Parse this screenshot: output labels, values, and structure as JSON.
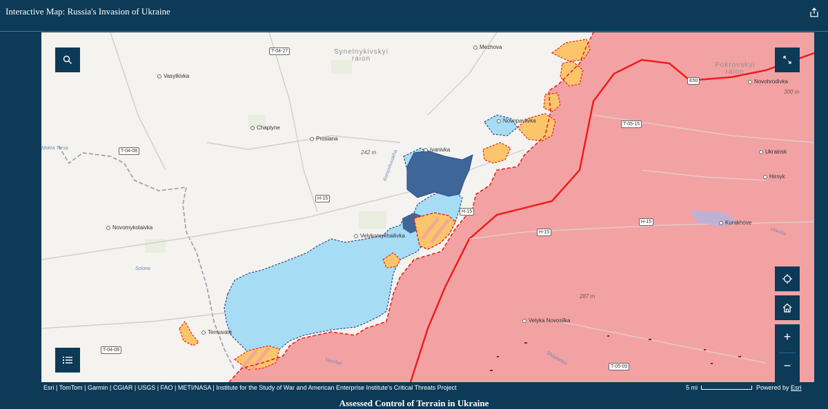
{
  "header": {
    "title": "Interactive Map: Russia's Invasion of Ukraine",
    "share_icon": "share-icon"
  },
  "map": {
    "raions": [
      {
        "name": "Synelnykivskyi\nraion"
      },
      {
        "name": "Pokrovskyi\nraion"
      }
    ],
    "places": [
      {
        "name": "Vasylkivka"
      },
      {
        "name": "Mezhova"
      },
      {
        "name": "Chaplyne"
      },
      {
        "name": "Prosiana"
      },
      {
        "name": "Novopavlivka"
      },
      {
        "name": "Ivanivka"
      },
      {
        "name": "Novohrodivka"
      },
      {
        "name": "Ukrainsk"
      },
      {
        "name": "Hirnyk"
      },
      {
        "name": "Kurakhove"
      },
      {
        "name": "Novomykolaivka"
      },
      {
        "name": "Velykomykhailivka"
      },
      {
        "name": "Velyka Novosilka"
      },
      {
        "name": "Ternuvate"
      }
    ],
    "roads": [
      "T-04-27",
      "E50",
      "T-05-15",
      "T-04-08",
      "H-15",
      "H-15",
      "H-15",
      "H-15",
      "T-04-08",
      "T-05-09"
    ],
    "rivers": [
      "Mokra Tersa",
      "Solona",
      "Vovcha",
      "Yanchur",
      "Shaytanka",
      "Komyshuvakha"
    ],
    "elevations": [
      "242 m",
      "300 m",
      "287 m"
    ],
    "colors": {
      "russian_control": "#f2a2a3",
      "contested": "#fbc56c",
      "ukrainian_advance": "#a7dcf5",
      "ukrainian_counteroffensive": "#3e6699",
      "frontline": "#ee1c1c",
      "base": "#f4f3ef",
      "chrome": "#0c3a57"
    },
    "controls": {
      "search_icon": "search-icon",
      "fullscreen_icon": "expand-icon",
      "locate_icon": "locate-icon",
      "home_icon": "home-icon",
      "zoom_in": "+",
      "zoom_out": "−",
      "legend_icon": "legend-list-icon"
    }
  },
  "footer": {
    "attribution": "Esri | TomTom | Garmin | CGIAR | USGS | FAO | METI/NASA | Institute for the Study of War and American Enterprise Institute's Critical Threats Project",
    "scale_label": "5 mi",
    "powered_by_prefix": "Powered by ",
    "powered_by_link": "Esri"
  },
  "caption": "Assessed Control of Terrain in Ukraine"
}
